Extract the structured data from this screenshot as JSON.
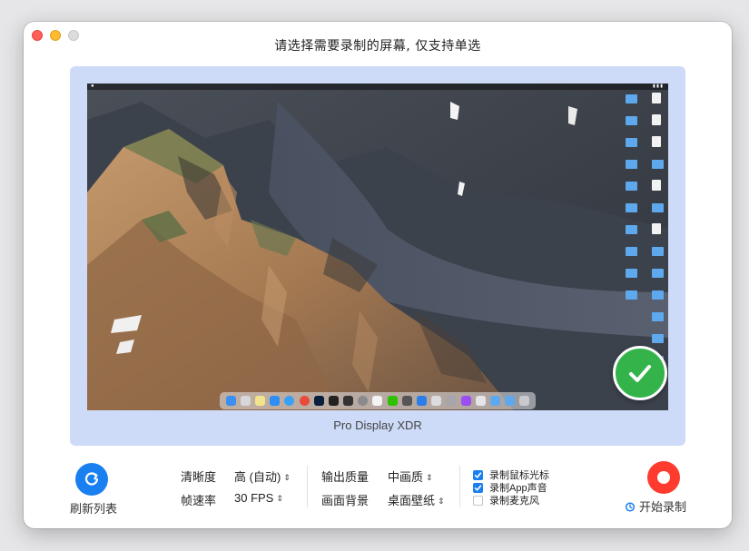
{
  "window": {
    "title": "请选择需要录制的屏幕, 仅支持单选"
  },
  "display": {
    "name": "Pro Display XDR",
    "selected": true
  },
  "actions": {
    "refresh_label": "刷新列表",
    "record_label": "开始录制"
  },
  "settings": {
    "resolution": {
      "label": "清晰度",
      "value": "高 (自动)"
    },
    "framerate": {
      "label": "帧速率",
      "value": "30 FPS"
    },
    "output_quality": {
      "label": "输出质量",
      "value": "中画质"
    },
    "background": {
      "label": "画面背景",
      "value": "桌面壁纸"
    }
  },
  "options": [
    {
      "label": "录制鼠标光标",
      "checked": true
    },
    {
      "label": "录制App声音",
      "checked": true
    },
    {
      "label": "录制麦克风",
      "checked": false
    }
  ],
  "colors": {
    "accent": "#1a7ff0",
    "record": "#ff3b30",
    "selection_bg": "#cddbf8",
    "check": "#33b34a"
  }
}
